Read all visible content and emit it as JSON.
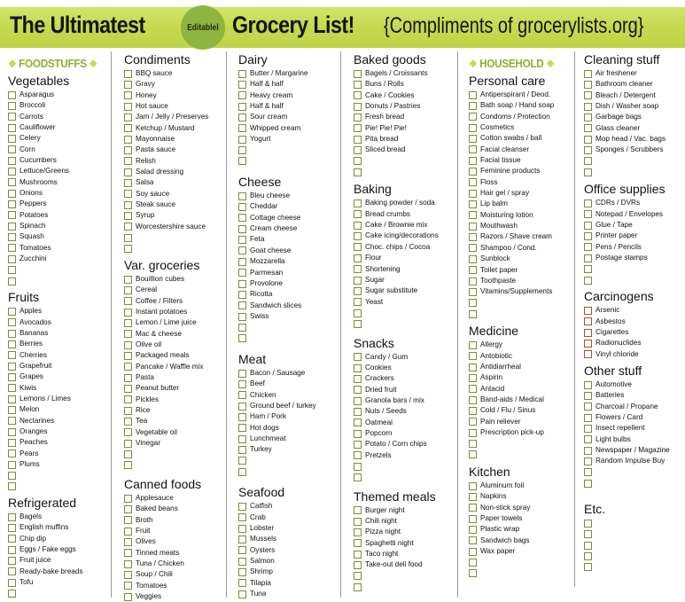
{
  "header": {
    "title_part1": "The Ultimatest",
    "badge": "EditableⅠ",
    "title_part2": "Grocery List!",
    "subtitle": "{Compliments of grocerylists.org}"
  },
  "colors": {
    "banner": "#c9dc56",
    "badge": "#8db640",
    "section_label": "#8db02e",
    "checkbox": "#7d8a3b",
    "checkbox_danger": "#a5522a"
  },
  "columns": [
    {
      "section": "FOODSTUFFS",
      "categories": [
        {
          "name": "Vegetables",
          "items": [
            "Asparagus",
            "Broccoli",
            "Carrots",
            "Cauliflower",
            "Celery",
            "Corn",
            "Cucumbers",
            "Lettuce/Greens",
            "Mushrooms",
            "Onions",
            "Peppers",
            "Potatoes",
            "Spinach",
            "Squash",
            "Tomatoes",
            "Zucchini",
            "",
            ""
          ]
        },
        {
          "name": "Fruits",
          "items": [
            "Apples",
            "Avocados",
            "Bananas",
            "Berries",
            "Cherries",
            "Grapefruit",
            "Grapes",
            "Kiwis",
            "Lemons / Limes",
            "Melon",
            "Nectarines",
            "Oranges",
            "Peaches",
            "Pears",
            "Plums",
            "",
            ""
          ]
        },
        {
          "name": "Refrigerated",
          "items": [
            "Bagels",
            "English muffins",
            "Chip dip",
            "Eggs / Fake eggs",
            "Fruit juice",
            "Ready-bake breads",
            "Tofu",
            ""
          ]
        }
      ]
    },
    {
      "categories": [
        {
          "name": "Condiments",
          "items": [
            "BBQ sauce",
            "Gravy",
            "Honey",
            "Hot sauce",
            "Jam / Jelly / Preserves",
            "Ketchup / Mustard",
            "Mayonnaise",
            "Pasta sauce",
            "Relish",
            "Salad dressing",
            "Salsa",
            "Soy sauce",
            "Steak sauce",
            "Syrup",
            "Worcestershire sauce",
            "",
            ""
          ]
        },
        {
          "name": "Var. groceries",
          "items": [
            "Bouillion cubes",
            "Cereal",
            "Coffee / Filters",
            "Instant potatoes",
            "Lemon / Lime juice",
            "Mac & cheese",
            "Olive oil",
            "Packaged meals",
            "Pancake / Waffle mix",
            "Pasta",
            "Peanut butter",
            "Pickles",
            "Rice",
            "Tea",
            "Vegetable oil",
            "Vinegar",
            "",
            ""
          ]
        },
        {
          "name": "Canned foods",
          "items": [
            "Applesauce",
            "Baked beans",
            "Broth",
            "Fruit",
            "Olives",
            "Tinned meats",
            "Tuna / Chicken",
            "Soup / Chili",
            "Tomatoes",
            "Veggies"
          ]
        }
      ]
    },
    {
      "categories": [
        {
          "name": "Dairy",
          "items": [
            "Butter / Margarine",
            "Half & half",
            "Heavy cream",
            "Half & half",
            "Sour cream",
            "Whipped cream",
            "Yogurt",
            "",
            ""
          ]
        },
        {
          "name": "Cheese",
          "items": [
            "Bleu cheese",
            "Cheddar",
            "Cottage cheese",
            "Cream cheese",
            "Feta",
            "Goat cheese",
            "Mozzarella",
            "Parmesan",
            "Provolone",
            "Ricotta",
            "Sandwich slices",
            "Swiss",
            "",
            ""
          ]
        },
        {
          "name": "Meat",
          "items": [
            "Bacon / Sausage",
            "Beef",
            "Chicken",
            "Ground beef / turkey",
            "Ham / Pork",
            "Hot dogs",
            "Lunchmeat",
            "Turkey",
            "",
            ""
          ]
        },
        {
          "name": "Seafood",
          "items": [
            "Catfish",
            "Crab",
            "Lobster",
            "Mussels",
            "Oysters",
            "Salmon",
            "Shrimp",
            "Tilapia",
            "Tuna"
          ]
        }
      ]
    },
    {
      "categories": [
        {
          "name": "Baked goods",
          "items": [
            "Bagels / Croissants",
            "Buns / Rolls",
            "Cake / Cookies",
            "Donuts / Pastries",
            "Fresh bread",
            "Pie! Pie! Pie!",
            "Pita bread",
            "Sliced bread",
            "",
            ""
          ]
        },
        {
          "name": "Baking",
          "items": [
            "Baking powder / soda",
            "Bread crumbs",
            "Cake / Brownie mix",
            "Cake icing/decorations",
            "Choc. chips / Cocoa",
            "Flour",
            "Shortening",
            "Sugar",
            "Sugar substitute",
            "Yeast",
            "",
            ""
          ]
        },
        {
          "name": "Snacks",
          "items": [
            "Candy / Gum",
            "Cookies",
            "Crackers",
            "Dried fruit",
            "Granola bars / mix",
            "Nuts / Seeds",
            "Oatmeal",
            "Popcorn",
            "Potato / Corn chips",
            "Pretzels",
            "",
            ""
          ]
        },
        {
          "name": "Themed meals",
          "items": [
            "Burger night",
            "Chili night",
            "Pizza night",
            "Spaghetti night",
            "Taco night",
            "Take-out deli food",
            "",
            ""
          ]
        }
      ]
    },
    {
      "section": "HOUSEHOLD",
      "categories": [
        {
          "name": "Personal care",
          "items": [
            "Antiperspirant / Deod.",
            "Bath soap / Hand soap",
            "Condoms / Protection",
            "Cosmetics",
            "Cotton swabs / ball",
            "Facial cleanser",
            "Facial tissue",
            "Feminine products",
            "Floss",
            "Hair gel / spray",
            "Lip balm",
            "Moisturing lotion",
            "Mouthwash",
            "Razors / Shave cream",
            "Shampoo / Cond.",
            "Sunblock",
            "Toilet paper",
            "Toothpaste",
            "Vitamins/Supplements",
            "",
            ""
          ]
        },
        {
          "name": "Medicine",
          "items": [
            "Allergy",
            "Antobiotic",
            "Antidiarrheal",
            "Aspirin",
            "Antacid",
            "Band-aids / Medical",
            "Cold / Flu / Sinus",
            "Pain reliever",
            "Prescription pick-up",
            "",
            ""
          ]
        },
        {
          "name": "Kitchen",
          "items": [
            "Aluminum foil",
            "Napkins",
            "Non-stick spray",
            "Paper towels",
            "Plastic wrap",
            "Sandwich bags",
            "Wax paper",
            "",
            ""
          ]
        }
      ]
    },
    {
      "categories": [
        {
          "name": "Cleaning stuff",
          "items": [
            "Air freshener",
            "Bathroom cleaner",
            "Bleach / Detergent",
            "Dish / Washer soap",
            "Garbage bags",
            "Glass cleaner",
            "Mop head / Vac. bags",
            "Sponges / Scrubbers",
            "",
            ""
          ]
        },
        {
          "name": "Office supplies",
          "items": [
            "CDRs / DVRs",
            "Notepad / Envelopes",
            "Glue / Tape",
            "Printer paper",
            "Pens / Pencils",
            "Postage stamps",
            "",
            ""
          ]
        },
        {
          "name": "Carcinogens",
          "danger": true,
          "items": [
            "Arsenic",
            "Asbestos",
            "Cigarettes",
            "Radionuclides",
            "Vinyl chloride"
          ]
        },
        {
          "name": "Other stuff",
          "items": [
            "Automotive",
            "Batteries",
            "Charcoal / Propane",
            "Flowers / Card",
            "Insect repellent",
            "Light bulbs",
            "Newspaper / Magazine",
            "Random Impulse Buy",
            "",
            ""
          ]
        },
        {
          "name": "Etc.",
          "items": [
            "",
            "",
            "",
            "",
            ""
          ]
        }
      ]
    }
  ]
}
